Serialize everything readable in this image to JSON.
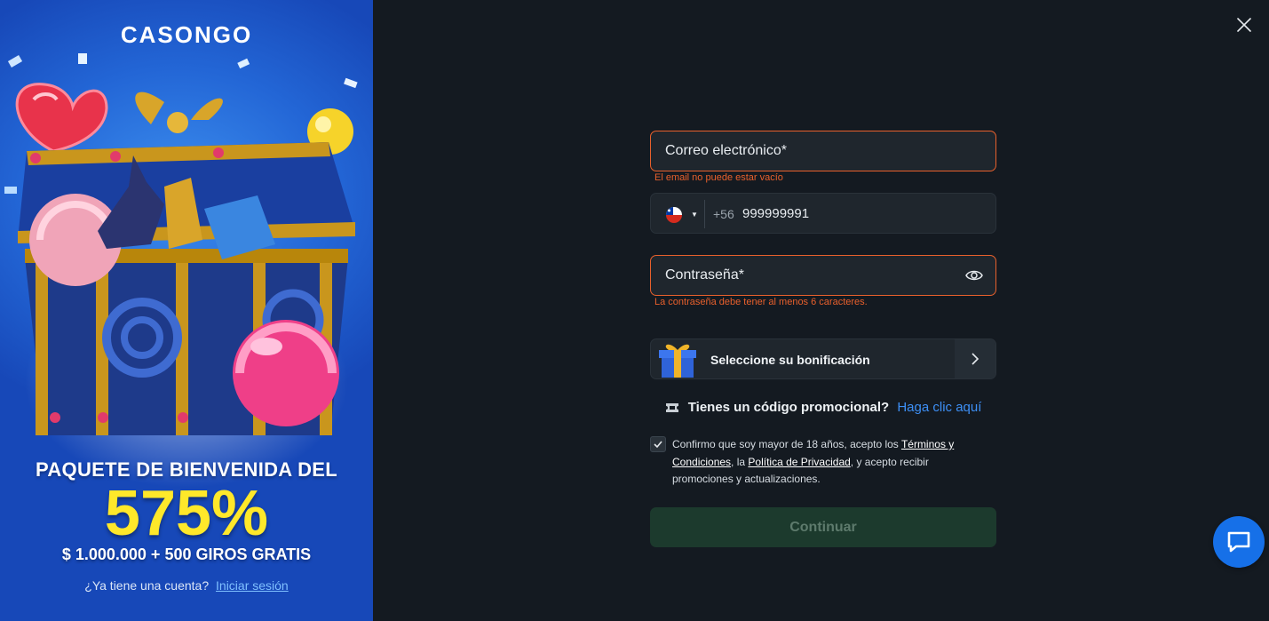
{
  "promo": {
    "brand": "CASONGO",
    "headline": "PAQUETE DE BIENVENIDA DEL",
    "percent": "575%",
    "subline": "$ 1.000.000 + 500 GIROS GRATIS",
    "login_prompt": "¿Ya tiene una cuenta?",
    "login_link": "Iniciar sesión"
  },
  "form": {
    "email": {
      "placeholder": "Correo electrónico*",
      "error": "El email no puede estar vacío"
    },
    "phone": {
      "country": "CL",
      "code": "+56",
      "value": "999999991"
    },
    "password": {
      "placeholder": "Contraseña*",
      "error": "La contraseña debe tener al menos 6 caracteres."
    },
    "bonus_label": "Seleccione su bonificación",
    "promo_question": "Tienes un código promocional?",
    "promo_link": "Haga clic aquí",
    "consent": {
      "checked": true,
      "t1": "Confirmo que soy mayor de 18 años, acepto los ",
      "terms": "Términos y Condiciones",
      "t2": ", la ",
      "privacy": "Política de Privacidad",
      "t3": ", y acepto recibir promociones y actualizaciones."
    },
    "continue_label": "Continuar"
  },
  "colors": {
    "error": "#e8602c",
    "accent_link": "#3d8ff5",
    "continue_bg": "#1c3a2d",
    "chat": "#1670e8"
  },
  "icons": {
    "close": "close-icon",
    "eye": "eye-icon",
    "gift": "gift-icon",
    "arrow": "chevron-right-icon",
    "ticket": "ticket-icon",
    "chat": "chat-icon",
    "flag": "chile-flag-icon"
  }
}
